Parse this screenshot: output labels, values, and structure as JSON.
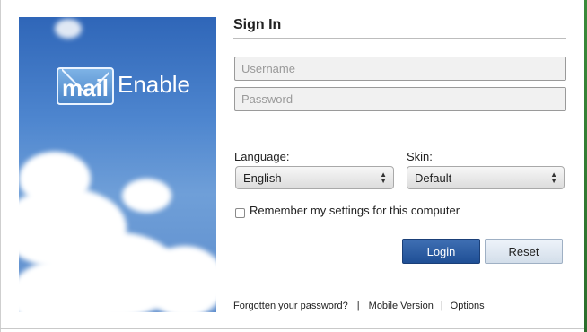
{
  "logo": {
    "part1": "mail",
    "part2": "Enable"
  },
  "signin": {
    "title": "Sign In",
    "username_placeholder": "Username",
    "password_placeholder": "Password",
    "language_label": "Language:",
    "language_value": "English",
    "skin_label": "Skin:",
    "skin_value": "Default",
    "remember_label": "Remember my settings for this computer",
    "login_label": "Login",
    "reset_label": "Reset"
  },
  "footer": {
    "forgot": "Forgotten your password?",
    "sep1": "|",
    "mobile": "Mobile Version",
    "sep2": "|",
    "options": "Options"
  },
  "colors": {
    "accent": "#2a5aa0",
    "sky": "#4e86cf"
  }
}
